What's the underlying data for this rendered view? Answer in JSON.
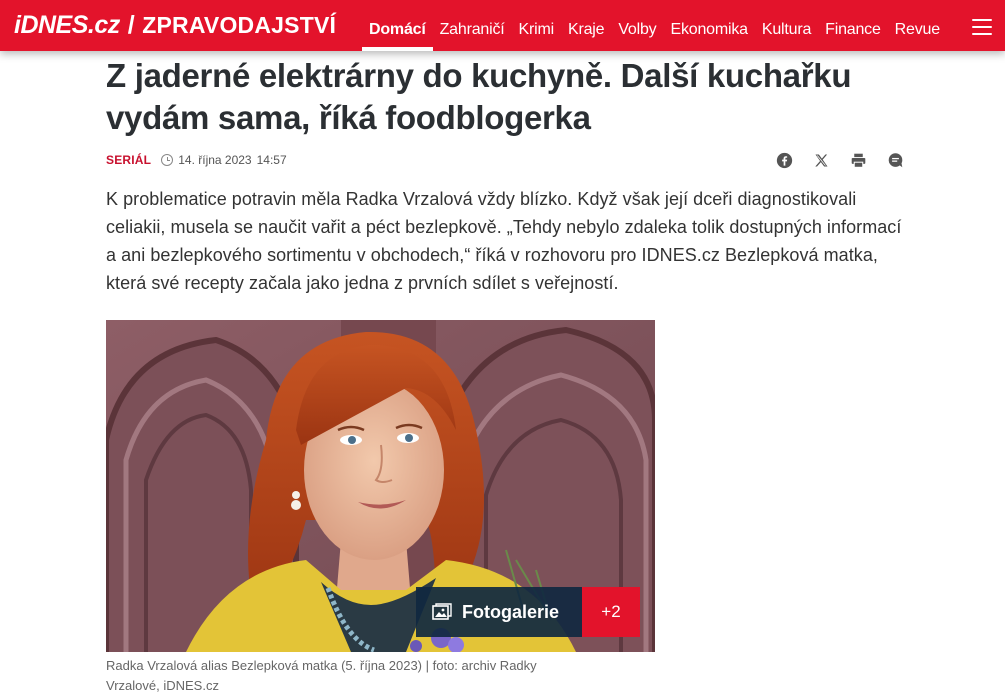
{
  "site": {
    "logo": "iDNES.cz",
    "separator": "/",
    "section": "ZPRAVODAJSTVÍ"
  },
  "nav": {
    "items": [
      "Domácí",
      "Zahraničí",
      "Krimi",
      "Kraje",
      "Volby",
      "Ekonomika",
      "Kultura",
      "Finance",
      "Revue"
    ],
    "active": "Domácí",
    "menu_icon": "hamburger-icon"
  },
  "article": {
    "title": "Z jaderné elektrárny do kuchyně. Další kuchařku vydám sama, říká foodblogerka",
    "tag": "SERIÁL",
    "date": "14. října 2023",
    "time": "14:57",
    "lead": "K problematice potravin měla Radka Vrzalová vždy blízko. Když však její dceři diagnostikovali celiakii, musela se naučit vařit a péct bezlepkově. „Tehdy nebylo zdaleka tolik dostupných informací a ani bezlepkového sortimentu v obchodech,“ říká v rozhovoru pro IDNES.cz Bezlepková matka, která své recepty začala jako jedna z prvních sdílet s veřejností.",
    "share_icons": [
      "facebook-icon",
      "x-icon",
      "print-icon",
      "comments-icon"
    ]
  },
  "photo": {
    "gallery_label": "Fotogalerie",
    "gallery_count": "+2",
    "caption": "Radka Vrzalová alias Bezlepková matka (5. října 2023) | foto: archiv Radky Vrzalové, iDNES.cz"
  },
  "colors": {
    "brand_red": "#e3132b",
    "tag_red": "#c8102e",
    "gallery_navy": "#102840"
  }
}
